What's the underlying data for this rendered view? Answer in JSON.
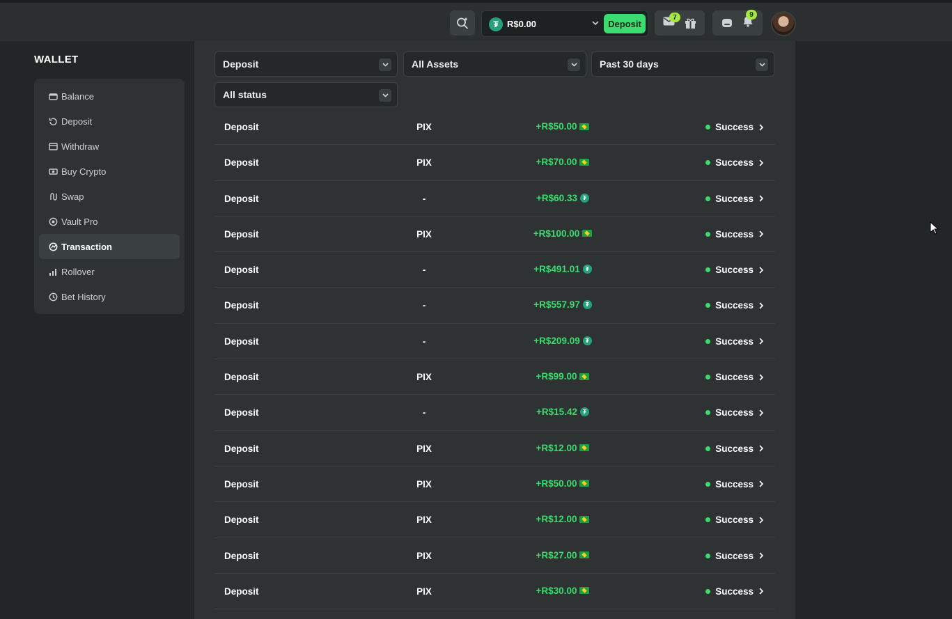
{
  "header": {
    "balance": "R$0.00",
    "balance_currency_icon": "usdt-icon",
    "deposit_label": "Deposit",
    "mail_badge": "7",
    "notification_badge": "9"
  },
  "sidebar": {
    "title": "WALLET",
    "items": [
      {
        "label": "Balance",
        "icon": "wallet-icon"
      },
      {
        "label": "Deposit",
        "icon": "deposit-icon"
      },
      {
        "label": "Withdraw",
        "icon": "withdraw-icon"
      },
      {
        "label": "Buy Crypto",
        "icon": "buy-crypto-icon"
      },
      {
        "label": "Swap",
        "icon": "swap-icon"
      },
      {
        "label": "Vault Pro",
        "icon": "vault-icon"
      },
      {
        "label": "Transaction",
        "icon": "transaction-icon",
        "active": true
      },
      {
        "label": "Rollover",
        "icon": "rollover-icon"
      },
      {
        "label": "Bet History",
        "icon": "clock-icon"
      }
    ]
  },
  "filters": {
    "type": "Deposit",
    "assets": "All Assets",
    "period": "Past 30 days",
    "status": "All status"
  },
  "transactions": [
    {
      "type": "Deposit",
      "method": "PIX",
      "amount": "+R$50.00",
      "currency_icon": "brazil-flag-icon",
      "status": "Success"
    },
    {
      "type": "Deposit",
      "method": "PIX",
      "amount": "+R$70.00",
      "currency_icon": "brazil-flag-icon",
      "status": "Success"
    },
    {
      "type": "Deposit",
      "method": "-",
      "amount": "+R$60.33",
      "currency_icon": "usdt-icon",
      "status": "Success"
    },
    {
      "type": "Deposit",
      "method": "PIX",
      "amount": "+R$100.00",
      "currency_icon": "brazil-flag-icon",
      "status": "Success"
    },
    {
      "type": "Deposit",
      "method": "-",
      "amount": "+R$491.01",
      "currency_icon": "usdt-icon",
      "status": "Success"
    },
    {
      "type": "Deposit",
      "method": "-",
      "amount": "+R$557.97",
      "currency_icon": "usdt-icon",
      "status": "Success"
    },
    {
      "type": "Deposit",
      "method": "-",
      "amount": "+R$209.09",
      "currency_icon": "usdt-icon",
      "status": "Success"
    },
    {
      "type": "Deposit",
      "method": "PIX",
      "amount": "+R$99.00",
      "currency_icon": "brazil-flag-icon",
      "status": "Success"
    },
    {
      "type": "Deposit",
      "method": "-",
      "amount": "+R$15.42",
      "currency_icon": "usdt-icon",
      "status": "Success"
    },
    {
      "type": "Deposit",
      "method": "PIX",
      "amount": "+R$12.00",
      "currency_icon": "brazil-flag-icon",
      "status": "Success"
    },
    {
      "type": "Deposit",
      "method": "PIX",
      "amount": "+R$50.00",
      "currency_icon": "brazil-flag-icon",
      "status": "Success"
    },
    {
      "type": "Deposit",
      "method": "PIX",
      "amount": "+R$12.00",
      "currency_icon": "brazil-flag-icon",
      "status": "Success"
    },
    {
      "type": "Deposit",
      "method": "PIX",
      "amount": "+R$27.00",
      "currency_icon": "brazil-flag-icon",
      "status": "Success"
    },
    {
      "type": "Deposit",
      "method": "PIX",
      "amount": "+R$30.00",
      "currency_icon": "brazil-flag-icon",
      "status": "Success"
    }
  ],
  "colors": {
    "accent_green": "#3bdc6f",
    "badge_green": "#a6e843",
    "background": "#232626",
    "panel": "#2e3232"
  }
}
